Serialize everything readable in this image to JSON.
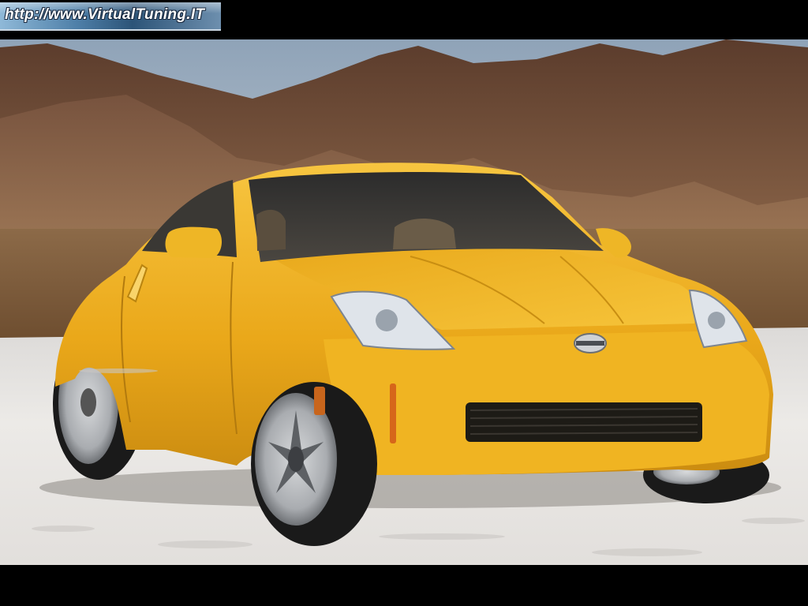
{
  "watermark": {
    "text": "http://www.VirtualTuning.IT"
  },
  "photo": {
    "subject": "yellow-sports-coupe",
    "colors": {
      "sky": "#9fb0c2",
      "mountains": "#6b4a36",
      "desert": "#7a5a3a",
      "salt_flat": "#e9e7e4",
      "car_body": "#f2b21c"
    }
  }
}
